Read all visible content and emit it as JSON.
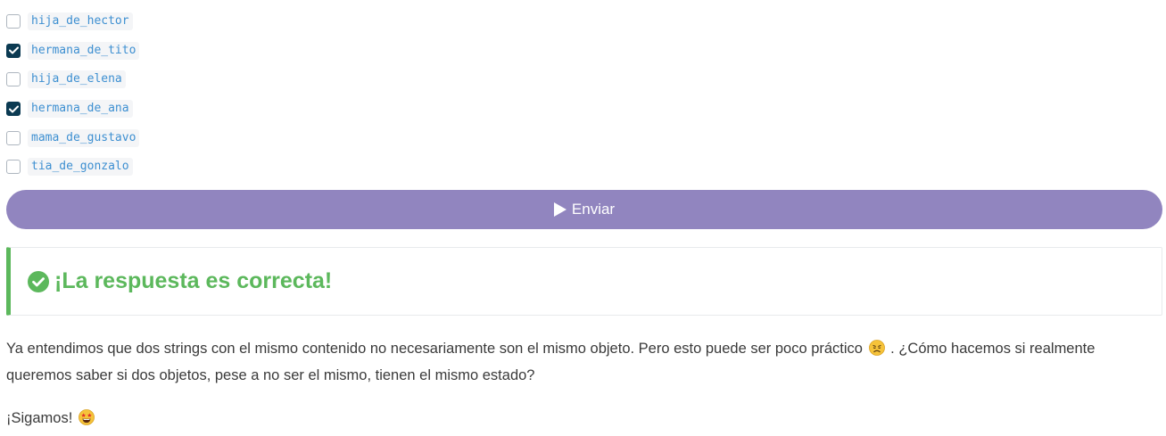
{
  "options": [
    {
      "label": "hija_de_hector",
      "checked": false
    },
    {
      "label": "hermana_de_tito",
      "checked": true
    },
    {
      "label": "hija_de_elena",
      "checked": false
    },
    {
      "label": "hermana_de_ana",
      "checked": true
    },
    {
      "label": "mama_de_gustavo",
      "checked": false
    },
    {
      "label": "tia_de_gonzalo",
      "checked": false
    }
  ],
  "submit": {
    "label": "Enviar",
    "icon": "play-icon",
    "color": "#9185bf"
  },
  "result": {
    "icon": "check-circle-icon",
    "title": "¡La respuesta es correcta!",
    "color": "#5cb85c"
  },
  "paragraphs": {
    "p1_before_emoji": "Ya entendimos que dos strings con el mismo contenido no necesariamente son el mismo objeto. Pero esto puede ser poco práctico",
    "p1_emoji": "disappointed-face-emoji",
    "p1_after_emoji": ". ¿Cómo hacemos si realmente queremos saber si dos objetos, pese a no ser el mismo, tienen el mismo estado?",
    "p2_text": "¡Sigamos!",
    "p2_emoji": "star-struck-emoji"
  }
}
